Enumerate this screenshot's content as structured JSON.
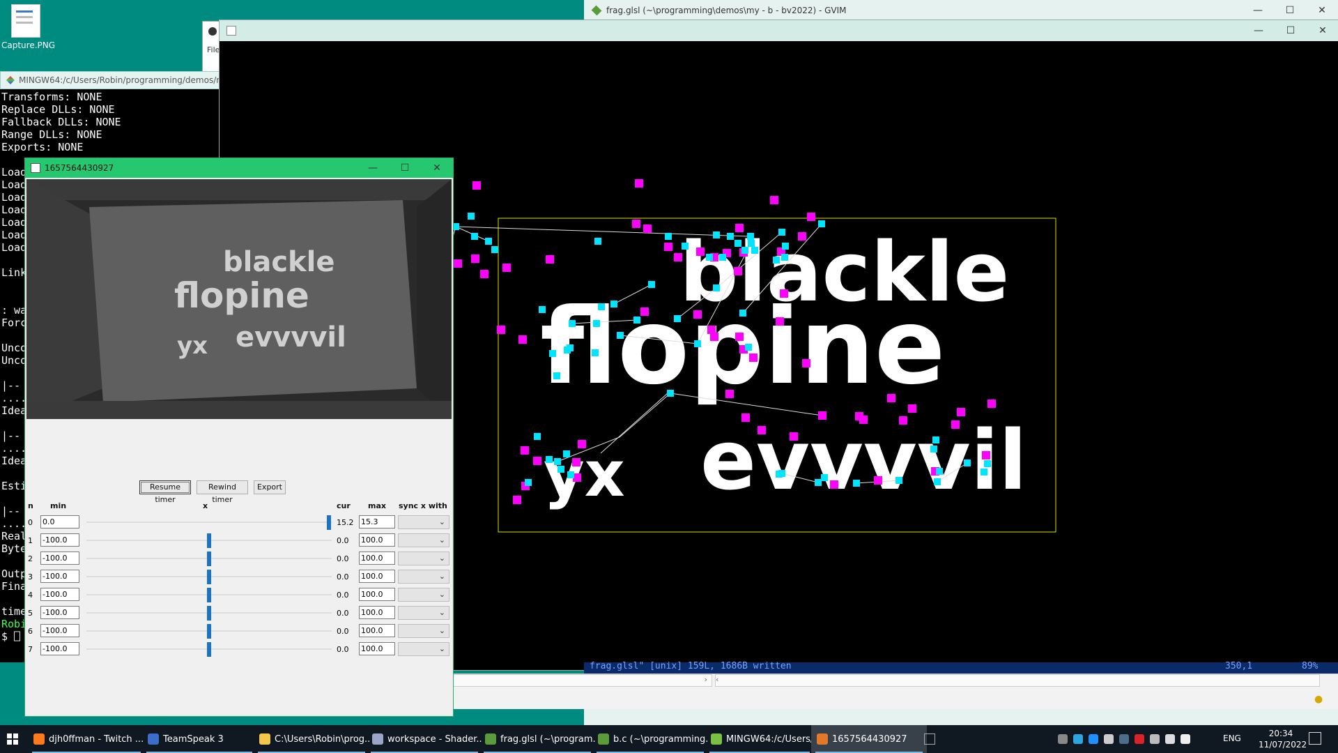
{
  "desktop": {
    "icon_label": "Capture.PNG"
  },
  "explorer": {
    "menu_label": "File"
  },
  "terminal": {
    "title": "MINGW64:/c/Users/Robin/programming/demos/my",
    "lines": [
      "Transforms: NONE",
      "Replace DLLs: NONE",
      "Fallback DLLs: NONE",
      "Range DLLs: NONE",
      "Exports: NONE",
      "",
      "Load",
      "Load",
      "Load",
      "Load",
      "Load",
      "Load",
      "Load",
      "",
      "Link",
      "",
      "",
      ": wa",
      "Forc",
      "",
      "Unco",
      "Unco",
      "",
      "|-- ",
      "....",
      "Idea",
      "",
      "|-- ",
      "....",
      "Idea",
      "",
      "Esti",
      "",
      "|-- ",
      "....",
      "Real",
      "Byte",
      "",
      "Outp",
      "Fina",
      "",
      "time"
    ],
    "prompt_user": "Robi",
    "prompt_line": "$ ⎕"
  },
  "gvim": {
    "title": "frag.glsl (~\\programming\\demos\\my - b - bv2022) - GVIM",
    "status": "frag.glsl\" [unix] 159L, 1686B written",
    "pos": "350,1",
    "pct": "89%"
  },
  "demo_window": {
    "title": ""
  },
  "control_window": {
    "title": "1657564430927",
    "preview_words": [
      "blackle",
      "flopine",
      "yx",
      "evvvvil"
    ],
    "buttons": {
      "resume": "Resume timer",
      "rewind": "Rewind timer",
      "export": "Export"
    },
    "headers": {
      "n": "n",
      "min": "min",
      "x": "x",
      "cur": "cur",
      "max": "max",
      "sync": "sync x with"
    },
    "rows": [
      {
        "n": "0",
        "min": "0.0",
        "cur": "15.2",
        "max": "15.3",
        "pos": 0.99
      },
      {
        "n": "1",
        "min": "-100.0",
        "cur": "0.0",
        "max": "100.0",
        "pos": 0.5
      },
      {
        "n": "2",
        "min": "-100.0",
        "cur": "0.0",
        "max": "100.0",
        "pos": 0.5
      },
      {
        "n": "3",
        "min": "-100.0",
        "cur": "0.0",
        "max": "100.0",
        "pos": 0.5
      },
      {
        "n": "4",
        "min": "-100.0",
        "cur": "0.0",
        "max": "100.0",
        "pos": 0.5
      },
      {
        "n": "5",
        "min": "-100.0",
        "cur": "0.0",
        "max": "100.0",
        "pos": 0.5
      },
      {
        "n": "6",
        "min": "-100.0",
        "cur": "0.0",
        "max": "100.0",
        "pos": 0.5
      },
      {
        "n": "7",
        "min": "-100.0",
        "cur": "0.0",
        "max": "100.0",
        "pos": 0.5
      }
    ]
  },
  "canvas_text": [
    "blackle",
    "flopine",
    "yx",
    "evvvvil"
  ],
  "taskbar": {
    "items": [
      {
        "label": "djh0ffman - Twitch ...",
        "icon": "firefox-icon",
        "color": "#ff7a1a"
      },
      {
        "label": "TeamSpeak 3",
        "icon": "teamspeak-icon",
        "color": "#3b6ec8"
      },
      {
        "label": "C:\\Users\\Robin\\prog...",
        "icon": "folder-icon",
        "color": "#f3c84a"
      },
      {
        "label": "workspace - Shader...",
        "icon": "shader-icon",
        "color": "#9aa6c8"
      },
      {
        "label": "frag.glsl (~\\program...",
        "icon": "vim-icon",
        "color": "#5c9b3c"
      },
      {
        "label": "b.c (~\\programming...",
        "icon": "vim-icon",
        "color": "#5c9b3c"
      },
      {
        "label": "MINGW64:/c/Users/...",
        "icon": "mingw-icon",
        "color": "#7bc043"
      },
      {
        "label": "1657564430927",
        "icon": "java-icon",
        "color": "#e07a2a"
      }
    ],
    "language": "ENG",
    "time": "20:34",
    "date": "11/07/2022"
  },
  "colors": {
    "desktop": "#008b80",
    "accent_green": "#25c86f",
    "slider": "#1a73c8",
    "handle_magenta": "#ff00ff",
    "handle_cyan": "#00e5ff"
  }
}
